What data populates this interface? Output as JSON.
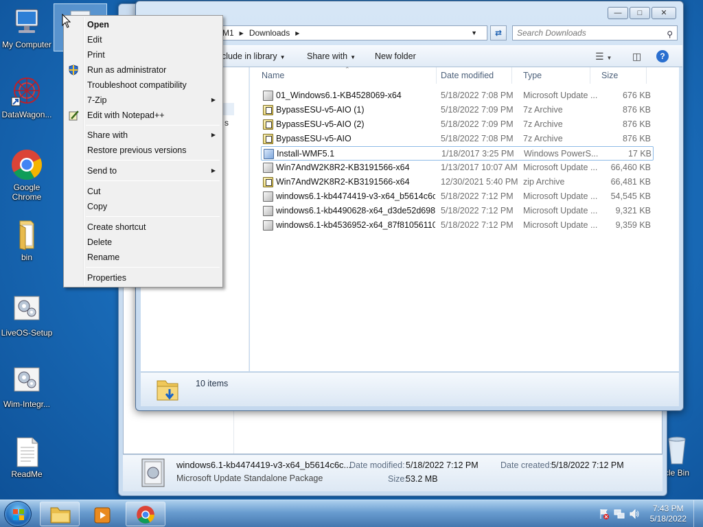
{
  "desktop": {
    "icons": [
      {
        "label": "My Computer"
      },
      {
        "label": "DataWagon..."
      },
      {
        "label": "Google Chrome"
      },
      {
        "label": "bin"
      },
      {
        "label": "LiveOS-Setup"
      },
      {
        "label": "Wim-Integr..."
      },
      {
        "label": "ReadMe"
      },
      {
        "label": "cle Bin"
      }
    ]
  },
  "context_menu": {
    "items": [
      {
        "label": "Open"
      },
      {
        "label": "Edit"
      },
      {
        "label": "Print"
      },
      {
        "label": "Run as administrator"
      },
      {
        "label": "Troubleshoot compatibility"
      },
      {
        "label": "7-Zip"
      },
      {
        "label": "Edit with Notepad++"
      },
      {
        "label": "Share with"
      },
      {
        "label": "Restore previous versions"
      },
      {
        "label": "Send to"
      },
      {
        "label": "Cut"
      },
      {
        "label": "Copy"
      },
      {
        "label": "Create shortcut"
      },
      {
        "label": "Delete"
      },
      {
        "label": "Rename"
      },
      {
        "label": "Properties"
      }
    ]
  },
  "explorer": {
    "breadcrumb": [
      "M1",
      "Downloads"
    ],
    "search_placeholder": "Search Downloads",
    "toolbar": {
      "include_in_library": "clude in library",
      "share_with": "Share with",
      "new_folder": "New folder"
    },
    "nav_partial_text": "s",
    "columns": {
      "name": "Name",
      "date": "Date modified",
      "type": "Type",
      "size": "Size"
    },
    "files": [
      {
        "name": "01_Windows6.1-KB4528069-x64",
        "date": "5/18/2022 7:08 PM",
        "type": "Microsoft Update ...",
        "size": "676 KB",
        "icon": "msu"
      },
      {
        "name": "BypassESU-v5-AIO (1)",
        "date": "5/18/2022 7:09 PM",
        "type": "7z Archive",
        "size": "876 KB",
        "icon": "zip"
      },
      {
        "name": "BypassESU-v5-AIO (2)",
        "date": "5/18/2022 7:09 PM",
        "type": "7z Archive",
        "size": "876 KB",
        "icon": "zip"
      },
      {
        "name": "BypassESU-v5-AIO",
        "date": "5/18/2022 7:08 PM",
        "type": "7z Archive",
        "size": "876 KB",
        "icon": "zip"
      },
      {
        "name": "Install-WMF5.1",
        "date": "1/18/2017 3:25 PM",
        "type": "Windows PowerS...",
        "size": "17 KB",
        "icon": "ps"
      },
      {
        "name": "Win7AndW2K8R2-KB3191566-x64",
        "date": "1/13/2017 10:07 AM",
        "type": "Microsoft Update ...",
        "size": "66,460 KB",
        "icon": "msu"
      },
      {
        "name": "Win7AndW2K8R2-KB3191566-x64",
        "date": "12/30/2021 5:40 PM",
        "type": "zip Archive",
        "size": "66,481 KB",
        "icon": "zip"
      },
      {
        "name": "windows6.1-kb4474419-v3-x64_b5614c6c...",
        "date": "5/18/2022 7:12 PM",
        "type": "Microsoft Update ...",
        "size": "54,545 KB",
        "icon": "msu"
      },
      {
        "name": "windows6.1-kb4490628-x64_d3de52d698...",
        "date": "5/18/2022 7:12 PM",
        "type": "Microsoft Update ...",
        "size": "9,321 KB",
        "icon": "msu"
      },
      {
        "name": "windows6.1-kb4536952-x64_87f81056110...",
        "date": "5/18/2022 7:12 PM",
        "type": "Microsoft Update ...",
        "size": "9,359 KB",
        "icon": "msu"
      }
    ],
    "status": "10 items"
  },
  "details_pane": {
    "filename": "windows6.1-kb4474419-v3-x64_b5614c6c...",
    "filetype": "Microsoft Update Standalone Package",
    "date_modified_label": "Date modified:",
    "date_modified": "5/18/2022 7:12 PM",
    "date_created_label": "Date created:",
    "date_created": "5/18/2022 7:12 PM",
    "size_label": "Size:",
    "size": "53.2 MB"
  },
  "taskbar": {
    "time": "7:43 PM",
    "date": "5/18/2022"
  }
}
